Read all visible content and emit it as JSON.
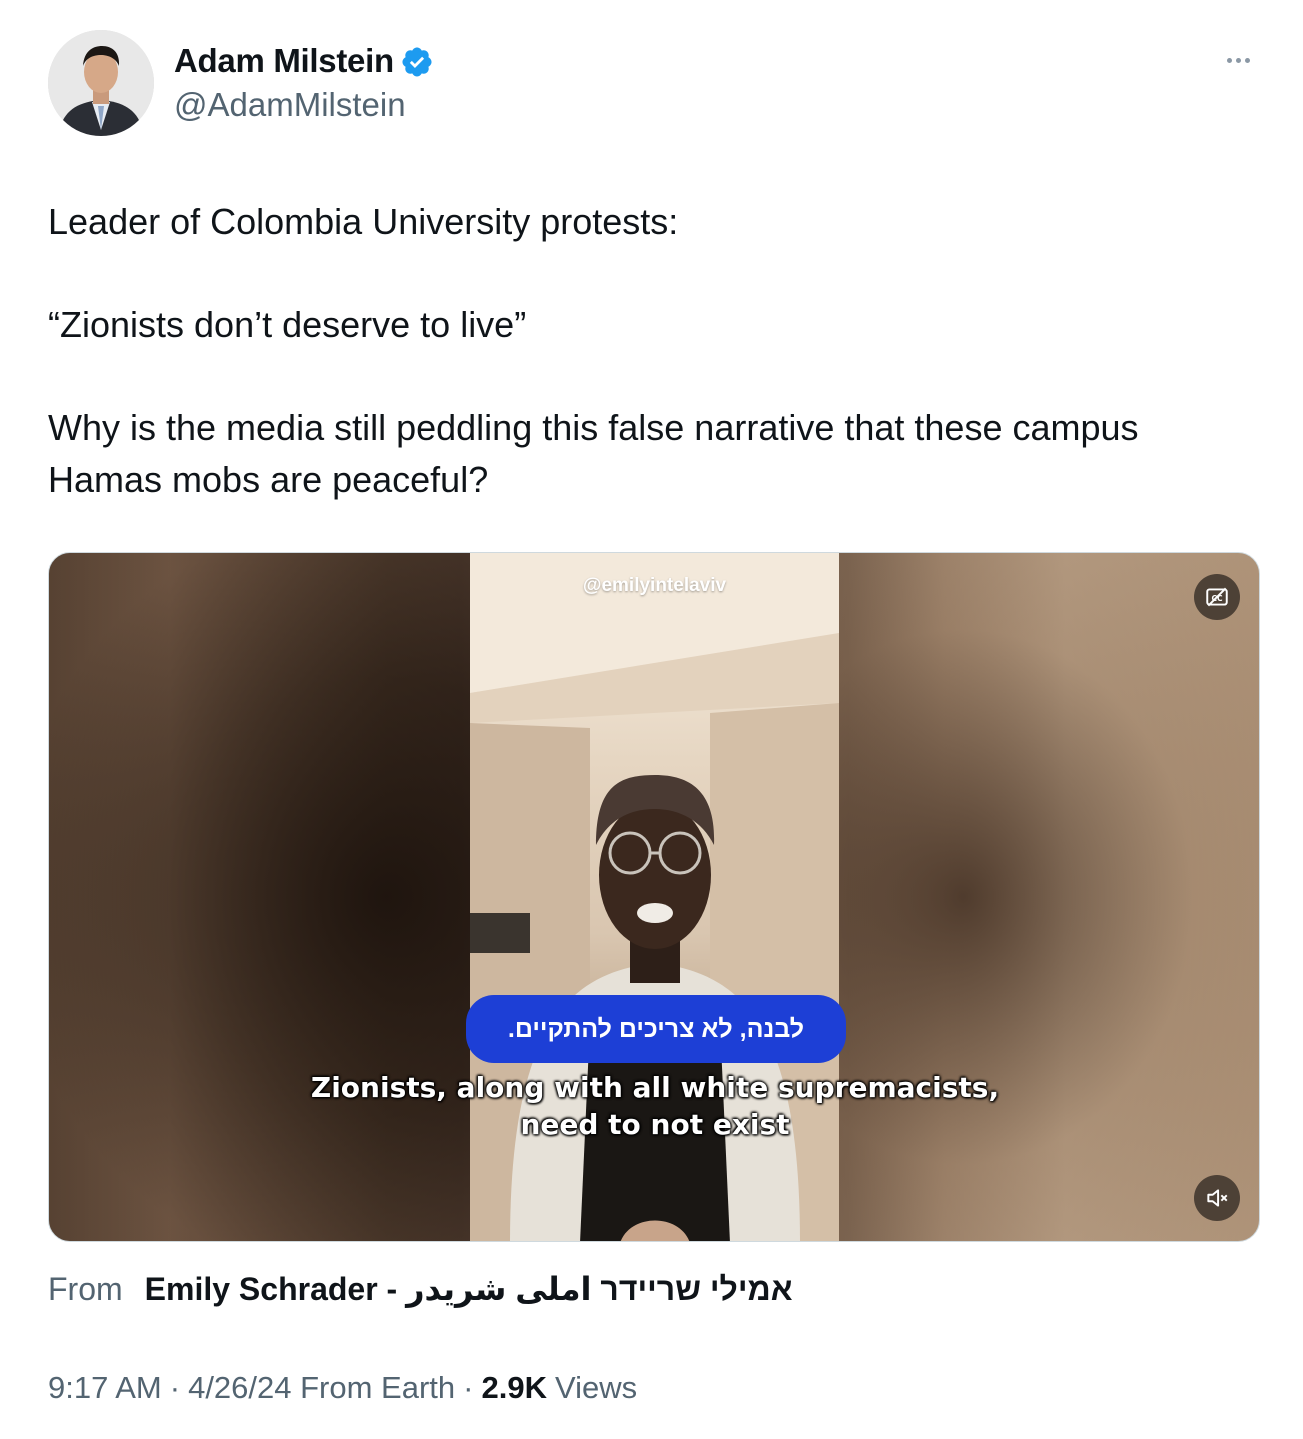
{
  "author": {
    "display_name": "Adam Milstein",
    "handle": "@AdamMilstein",
    "verified": true,
    "verified_color": "#1d9bf0"
  },
  "tweet": {
    "lines": [
      "Leader of Colombia University protests:",
      "“Zionists don’t deserve to live”",
      "Why is the media still peddling this false narrative that these campus Hamas mobs are peaceful?"
    ]
  },
  "media": {
    "watermark": "@emilyintelaviv",
    "caption_hebrew": "לבנה, לא צריכים להתקיים.",
    "caption_english_line1": "Zionists, along with all white supremacists,",
    "caption_english_line2": "need to not exist",
    "caption_badge_color": "#1d3fd6",
    "cc_icon": "captions-off-icon",
    "mute_icon": "muted-speaker-icon"
  },
  "source": {
    "from_label": "From",
    "name": "Emily Schrader - אמילי שריידר املی شریدر"
  },
  "meta": {
    "time": "9:17 AM",
    "date_location": "4/26/24 From Earth",
    "views_count": "2.9K",
    "views_label": "Views"
  },
  "icons": {
    "more": "more-options-icon",
    "verified": "verified-badge-icon"
  }
}
